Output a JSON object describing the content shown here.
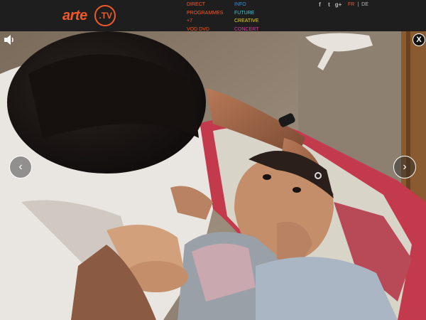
{
  "brand": {
    "word": "arte",
    "tv": ".TV",
    "color": "#f05a28"
  },
  "nav": {
    "left": [
      {
        "label": "DIRECT",
        "color": "#f05a28"
      },
      {
        "label": "PROGRAMMES",
        "color": "#f05a28"
      },
      {
        "label": "+7",
        "color": "#f05a28"
      },
      {
        "label": "VOD DVD",
        "color": "#f05a28"
      }
    ],
    "right": [
      {
        "label": "INFO",
        "color": "#3b8fd6"
      },
      {
        "label": "FUTURE",
        "color": "#3ec7d8"
      },
      {
        "label": "CREATIVE",
        "color": "#e8d21e"
      },
      {
        "label": "CONCERT",
        "color": "#d63da0"
      }
    ]
  },
  "social": {
    "icons": [
      "facebook-icon",
      "twitter-icon",
      "google-plus-icon"
    ],
    "glyphs": [
      "f",
      "t",
      "g+"
    ]
  },
  "languages": {
    "active": "FR",
    "separator": "|",
    "other": "DE",
    "active_color": "#f05a28"
  },
  "viewer": {
    "close_glyph": "X",
    "prev_glyph": "‹",
    "next_glyph": "›"
  }
}
